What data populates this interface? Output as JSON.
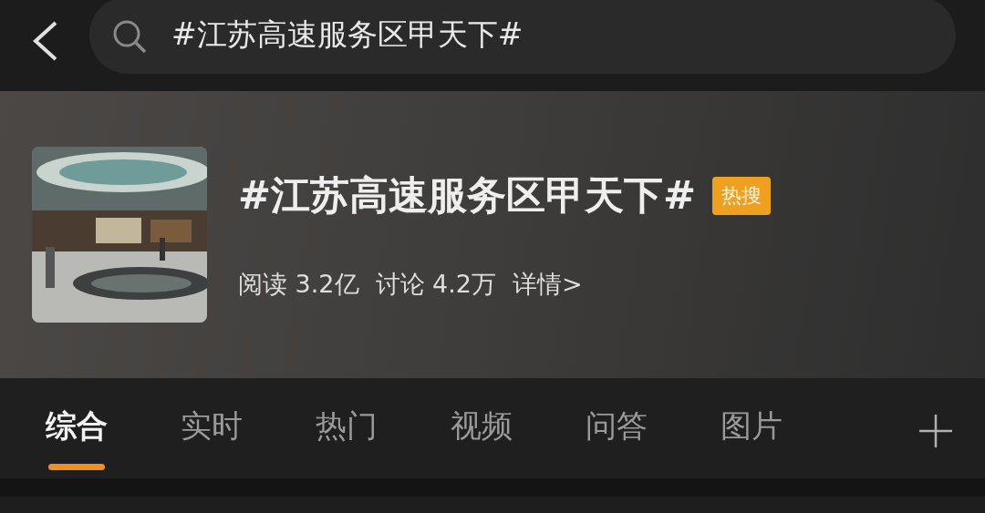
{
  "search": {
    "value": "#江苏高速服务区甲天下#"
  },
  "topic": {
    "kind": "picture",
    "title": "#江苏高速服务区甲天下#",
    "badge": "热搜",
    "reads": "阅读 3.2亿",
    "discussions": "讨论 4.2万",
    "details": "详情>"
  },
  "tabs": [
    {
      "label": "综合",
      "selected": true
    },
    {
      "label": "实时",
      "selected": false
    },
    {
      "label": "热门",
      "selected": false
    },
    {
      "label": "视频",
      "selected": false
    },
    {
      "label": "问答",
      "selected": false
    },
    {
      "label": "图片",
      "selected": false
    }
  ]
}
